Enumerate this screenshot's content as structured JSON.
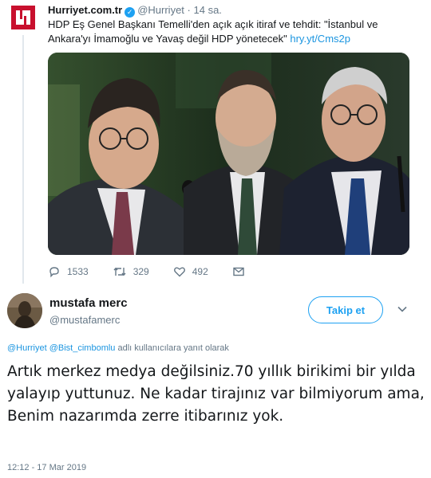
{
  "quoted_tweet": {
    "author_name": "Hurriyet.com.tr",
    "author_handle": "@Hurriyet",
    "separator": "·",
    "time": "14 sa.",
    "text": "HDP Eş Genel Başkanı Temelli'den açık açık itiraf ve tehdit: \"İstanbul ve Ankara'yı İmamoğlu ve Yavaş değil HDP yönetecek\"",
    "link": "hry.yt/Cms2p",
    "actions": {
      "reply_count": "1533",
      "retweet_count": "329",
      "like_count": "492"
    }
  },
  "reply_tweet": {
    "author_name": "mustafa merc",
    "author_handle": "@mustafamerc",
    "follow_label": "Takip et",
    "replying_to_mentions": [
      "@Hurriyet",
      "@Bist_cimbomlu"
    ],
    "replying_to_suffix": "adlı kullanıcılara yanıt olarak",
    "text": "Artık merkez medya değilsiniz.70 yıllık birikimi bir yılda yalayıp yuttunuz. Ne kadar tirajınız var bilmiyorum ama, Benim nazarımda zerre itibarınız yok.",
    "timestamp": "12:12 - 17 Mar 2019"
  },
  "colors": {
    "accent": "#1da1f2",
    "link": "#1b95e0",
    "muted": "#657786",
    "brand_red": "#c8102e"
  },
  "icons": [
    "hurriyet-logo",
    "verified-badge-icon",
    "reply-icon",
    "retweet-icon",
    "like-icon",
    "message-icon",
    "chevron-down-icon"
  ]
}
